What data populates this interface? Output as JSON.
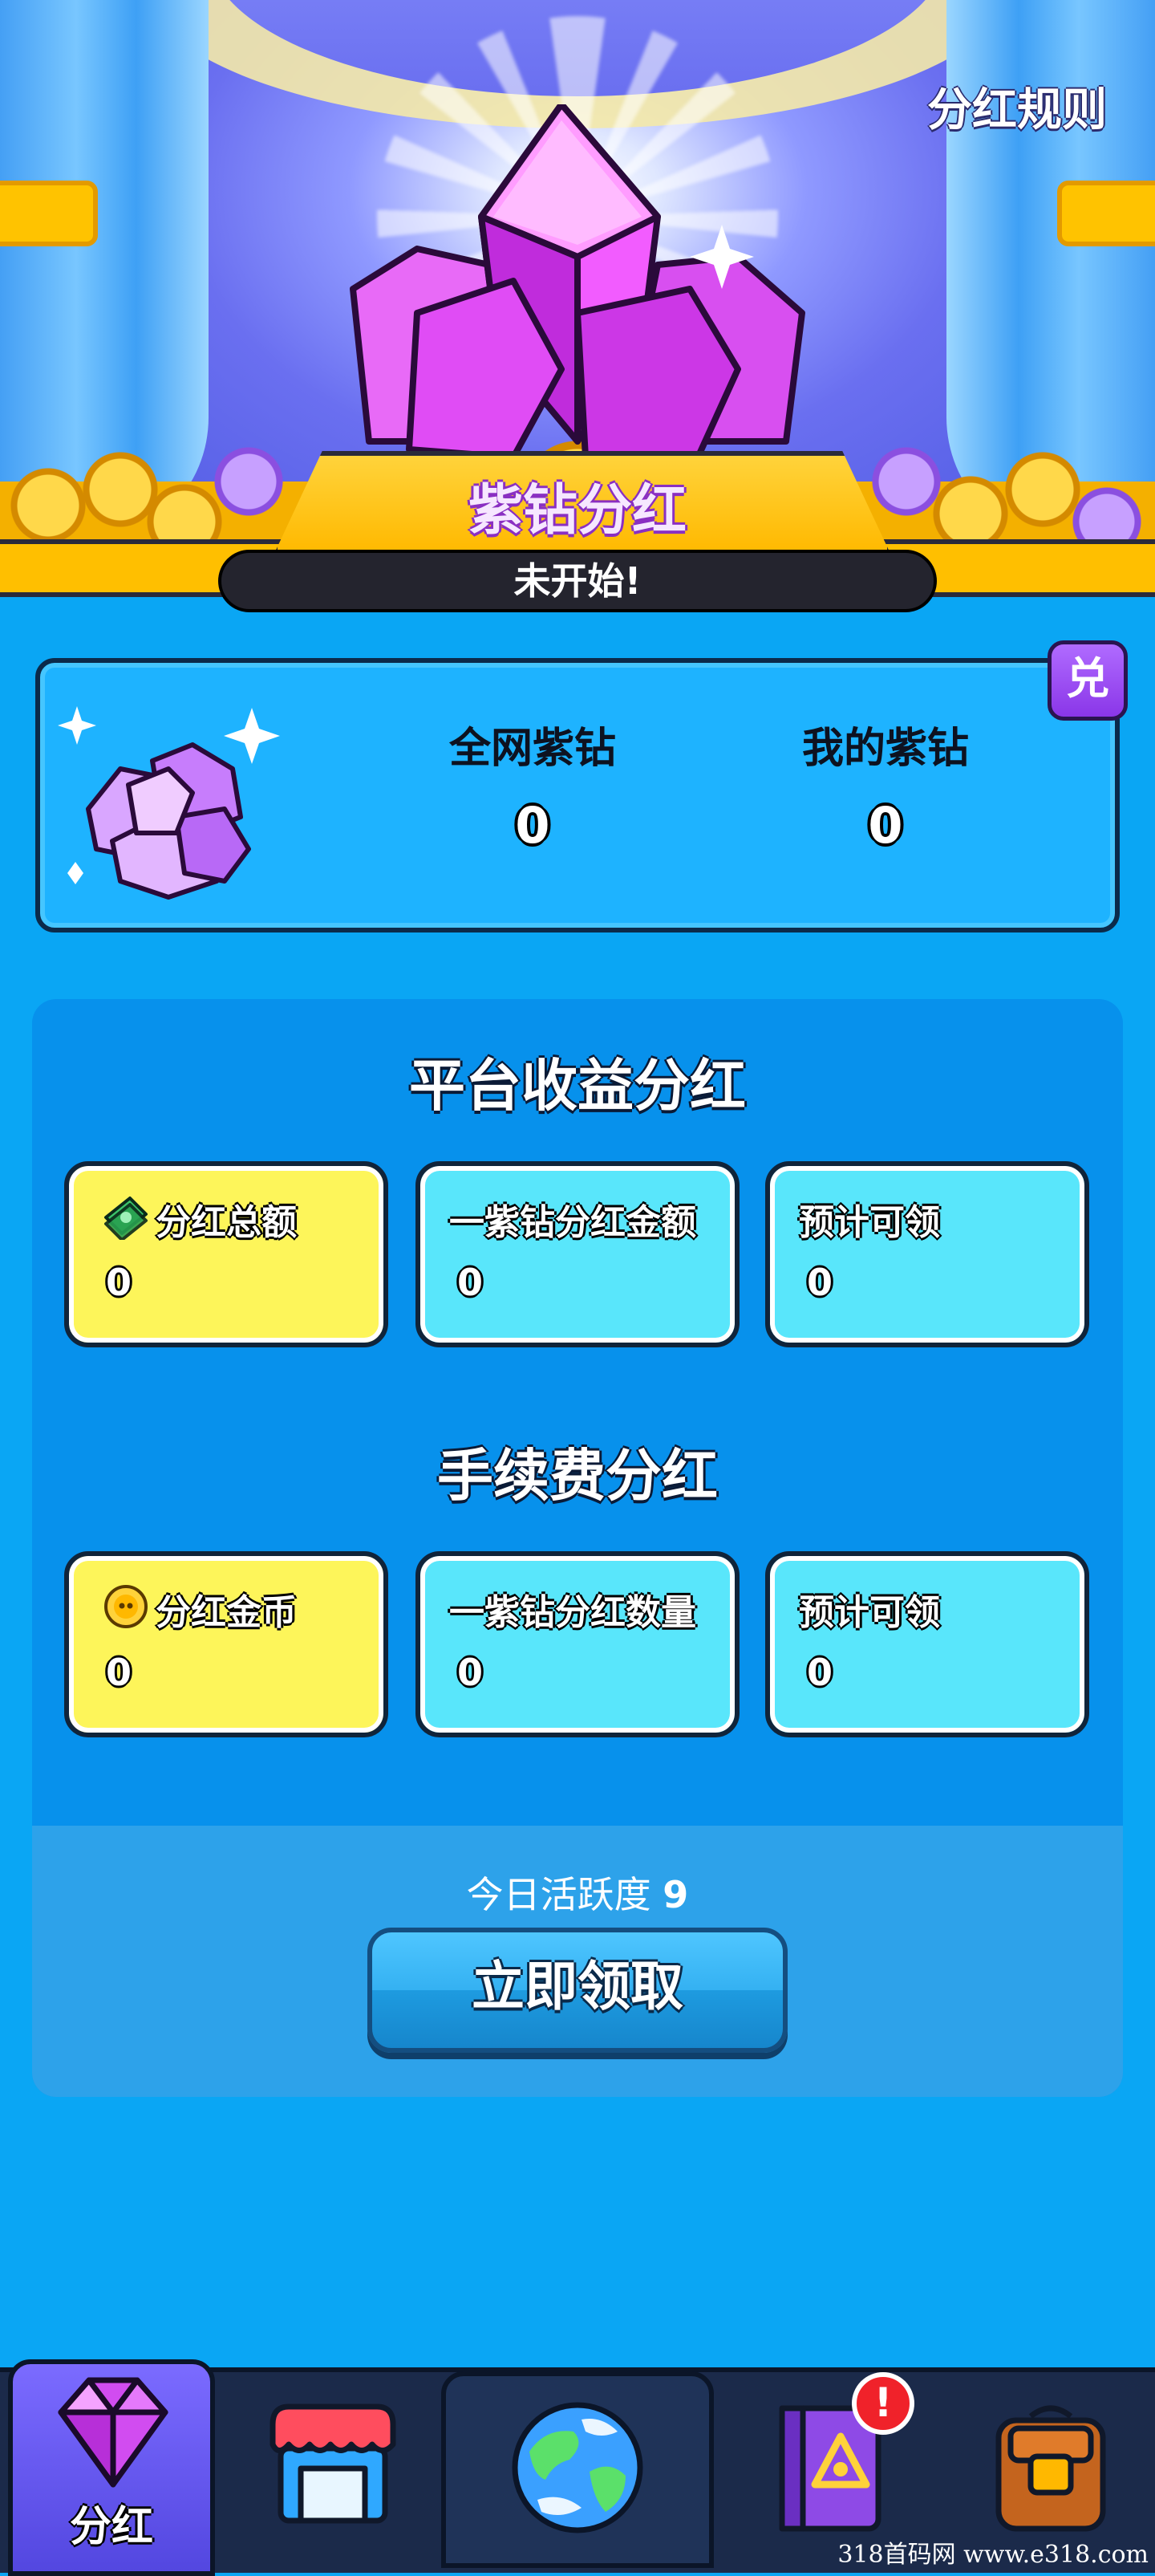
{
  "header": {
    "rules_link": "分红规则",
    "title": "紫钻分红",
    "status": "未开始!"
  },
  "gem_stats": {
    "exchange_label": "兑",
    "network_label": "全网紫钻",
    "network_value": "0",
    "mine_label": "我的紫钻",
    "mine_value": "0"
  },
  "platform": {
    "title": "平台收益分红",
    "tiles": [
      {
        "label": "分红总额",
        "value": "0",
        "icon": "cash-icon"
      },
      {
        "label": "一紫钻分红金额",
        "value": "0"
      },
      {
        "label": "预计可领",
        "value": "0"
      }
    ]
  },
  "fee": {
    "title": "手续费分红",
    "tiles": [
      {
        "label": "分红金币",
        "value": "0",
        "icon": "coin-icon"
      },
      {
        "label": "一紫钻分红数量",
        "value": "0"
      },
      {
        "label": "预计可领",
        "value": "0"
      }
    ]
  },
  "activity": {
    "label": "今日活跃度",
    "value": "9"
  },
  "claim_button": "立即领取",
  "nav": {
    "items": [
      {
        "label": "分红",
        "icon": "purple-gem-icon",
        "active": true
      },
      {
        "icon": "shop-icon"
      },
      {
        "icon": "globe-icon"
      },
      {
        "icon": "spellbook-icon",
        "badge": "!"
      },
      {
        "icon": "backpack-icon"
      }
    ]
  },
  "watermark": "318首码网 www.e318.com",
  "colors": {
    "background": "#0aa6f4",
    "panel": "#0791ec",
    "tile_yellow": "#fdf55a",
    "tile_cyan": "#59e6fb",
    "banner_gold": "#ffbf00",
    "gem_purple": "#d63ff0"
  }
}
